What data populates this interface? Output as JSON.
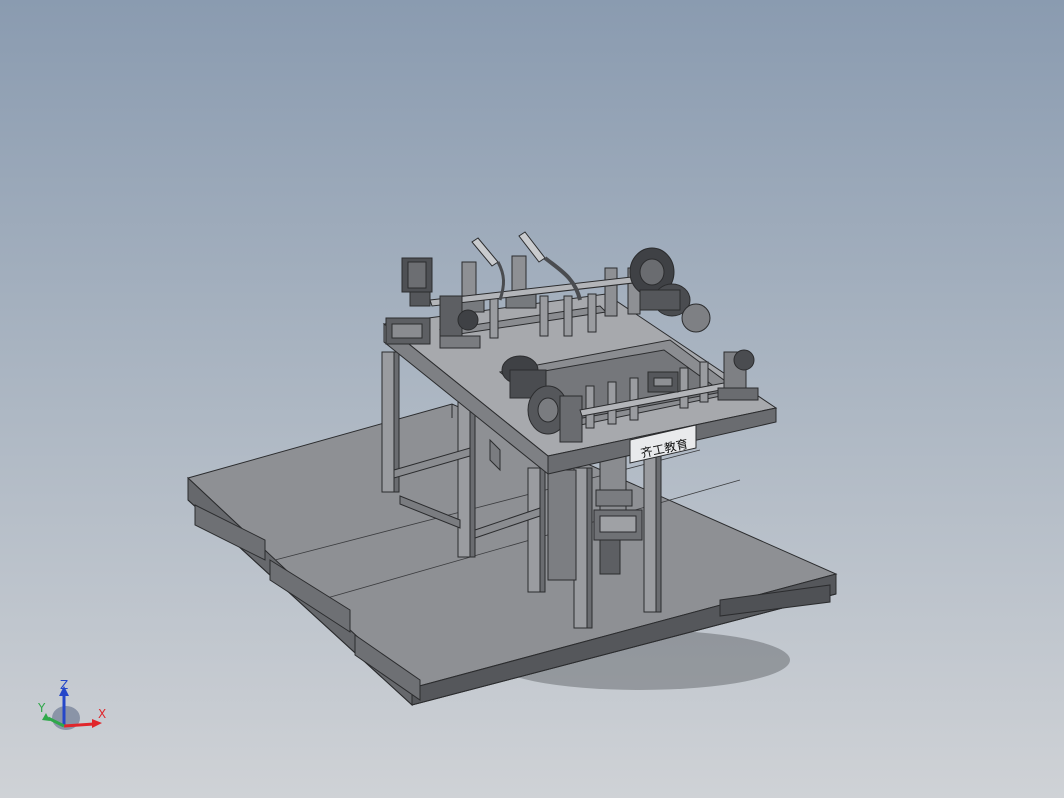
{
  "model": {
    "nameplate_text": "齐工教育"
  },
  "triad": {
    "x_label": "X",
    "y_label": "Y",
    "z_label": "Z",
    "x_color": "#e0262b",
    "y_color": "#2fa84a",
    "z_color": "#2547c9"
  },
  "colors": {
    "background_top": "#8a9bb0",
    "background_bottom": "#cfd2d6",
    "steel_light": "#a3a5a8",
    "steel_mid": "#8c8e92",
    "steel_dark": "#55575b",
    "edge": "#2b2c2e"
  }
}
